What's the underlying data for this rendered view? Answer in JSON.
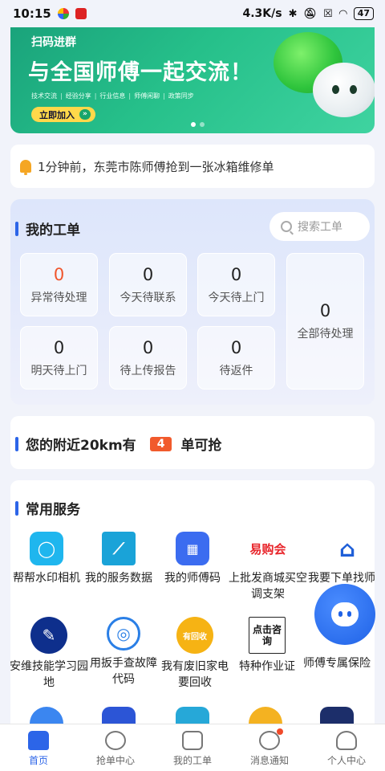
{
  "status_bar": {
    "time": "10:15",
    "network_speed": "4.3K/s",
    "battery": "47"
  },
  "banner": {
    "tag": "扫码进群",
    "headline": "与全国师傅一起交流！",
    "topics": [
      "技术交流",
      "经验分享",
      "行业信息",
      "师傅闲聊",
      "政策同步"
    ],
    "button_label": "立即加入",
    "button_arrow": "»",
    "accent_color": "#26c08a"
  },
  "notice": {
    "text": "1分钟前，东莞市陈师傅抢到一张冰箱维修单"
  },
  "work_orders": {
    "title": "我的工单",
    "search_placeholder": "搜索工单",
    "cards": [
      {
        "count": "0",
        "label": "异常待处理"
      },
      {
        "count": "0",
        "label": "今天待联系"
      },
      {
        "count": "0",
        "label": "今天待上门"
      },
      {
        "count": "0",
        "label": "全部待处理"
      },
      {
        "count": "0",
        "label": "明天待上门"
      },
      {
        "count": "0",
        "label": "待上传报告"
      },
      {
        "count": "0",
        "label": "待返件"
      }
    ]
  },
  "nearby": {
    "prefix": "您的附近20km有",
    "count": "4",
    "suffix": "单可抢"
  },
  "services": {
    "title": "常用服务",
    "items": [
      {
        "label": "帮帮水印相机",
        "icon": "camera-icon"
      },
      {
        "label": "我的服务数据",
        "icon": "chart-icon"
      },
      {
        "label": "我的师傅码",
        "icon": "qrcode-icon"
      },
      {
        "label": "上批发商城买空调支架",
        "icon": "mall-logo-icon",
        "logo_text": "易购会"
      },
      {
        "label": "我要下单找师傅",
        "icon": "wrench-house-icon"
      },
      {
        "label": "安维技能学习园地",
        "icon": "training-icon"
      },
      {
        "label": "用扳手查故障代码",
        "icon": "fault-code-icon"
      },
      {
        "label": "我有废旧家电要回收",
        "icon": "recycle-icon",
        "logo_text": "有回收"
      },
      {
        "label": "特种作业证",
        "icon": "consult-icon",
        "logo_text": "点击咨询"
      },
      {
        "label": "师傅专属保险",
        "icon": "insurance-icon"
      }
    ]
  },
  "tabbar": {
    "tabs": [
      {
        "label": "首页"
      },
      {
        "label": "抢单中心"
      },
      {
        "label": "我的工单"
      },
      {
        "label": "消息通知"
      },
      {
        "label": "个人中心"
      }
    ]
  }
}
